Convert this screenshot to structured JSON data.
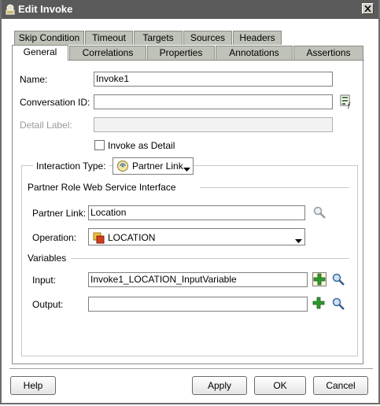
{
  "window": {
    "title": "Edit Invoke",
    "icon": "invoke-icon",
    "close_icon": "close-icon"
  },
  "tabs": {
    "row1": [
      "Skip Condition",
      "Timeout",
      "Targets",
      "Sources",
      "Headers"
    ],
    "row2": [
      "General",
      "Correlations",
      "Properties",
      "Annotations",
      "Assertions"
    ],
    "active": "General"
  },
  "form": {
    "name_label": "Name:",
    "name_value": "Invoke1",
    "conversation_label": "Conversation ID:",
    "conversation_value": "",
    "detail_label": "Detail Label:",
    "detail_value": "",
    "invoke_as_detail_label": "Invoke as Detail",
    "invoke_as_detail_checked": false
  },
  "interaction": {
    "type_label": "Interaction Type:",
    "type_value": "Partner Link",
    "section_title": "Partner Role Web Service Interface",
    "partner_link_label": "Partner Link:",
    "partner_link_value": "Location",
    "operation_label": "Operation:",
    "operation_value": "LOCATION"
  },
  "variables": {
    "section_title": "Variables",
    "input_label": "Input:",
    "input_value": "Invoke1_LOCATION_InputVariable",
    "output_label": "Output:",
    "output_value": ""
  },
  "buttons": {
    "help": "Help",
    "apply": "Apply",
    "ok": "OK",
    "cancel": "Cancel"
  }
}
